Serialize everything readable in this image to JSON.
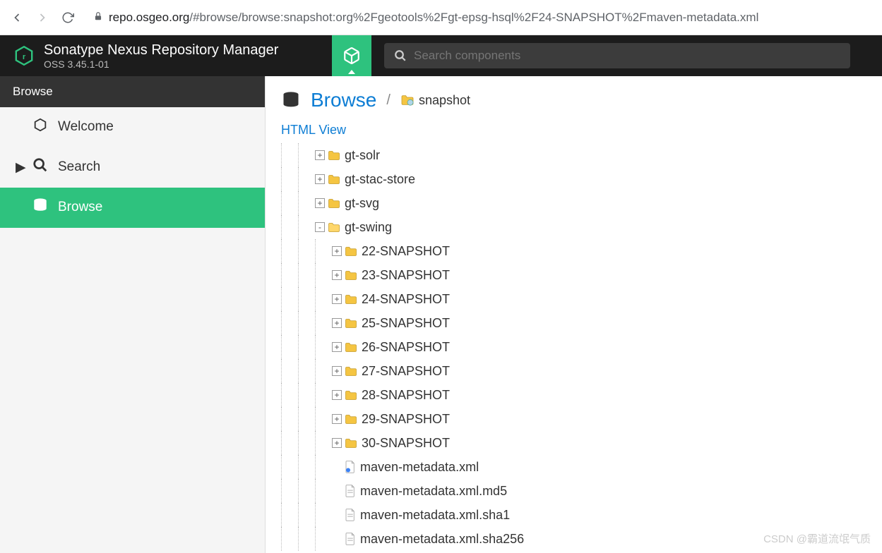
{
  "browser": {
    "url_prefix": "repo.osgeo.org",
    "url_path": "/#browse/browse:snapshot:org%2Fgeotools%2Fgt-epsg-hsql%2F24-SNAPSHOT%2Fmaven-metadata.xml"
  },
  "header": {
    "title": "Sonatype Nexus Repository Manager",
    "version": "OSS 3.45.1-01",
    "search_placeholder": "Search components"
  },
  "sidebar": {
    "header": "Browse",
    "items": [
      {
        "label": "Welcome",
        "icon": "hex",
        "active": false,
        "expandable": false
      },
      {
        "label": "Search",
        "icon": "search",
        "active": false,
        "expandable": true
      },
      {
        "label": "Browse",
        "icon": "db",
        "active": true,
        "expandable": false
      }
    ]
  },
  "breadcrumb": {
    "title": "Browse",
    "repo": "snapshot"
  },
  "links": {
    "html_view": "HTML View"
  },
  "tree": [
    {
      "depth": 2,
      "toggle": "+",
      "icon": "folder",
      "label": "gt-solr"
    },
    {
      "depth": 2,
      "toggle": "+",
      "icon": "folder",
      "label": "gt-stac-store"
    },
    {
      "depth": 2,
      "toggle": "+",
      "icon": "folder",
      "label": "gt-svg"
    },
    {
      "depth": 2,
      "toggle": "-",
      "icon": "folder-open",
      "label": "gt-swing"
    },
    {
      "depth": 3,
      "toggle": "+",
      "icon": "folder",
      "label": "22-SNAPSHOT"
    },
    {
      "depth": 3,
      "toggle": "+",
      "icon": "folder",
      "label": "23-SNAPSHOT"
    },
    {
      "depth": 3,
      "toggle": "+",
      "icon": "folder",
      "label": "24-SNAPSHOT"
    },
    {
      "depth": 3,
      "toggle": "+",
      "icon": "folder",
      "label": "25-SNAPSHOT"
    },
    {
      "depth": 3,
      "toggle": "+",
      "icon": "folder",
      "label": "26-SNAPSHOT"
    },
    {
      "depth": 3,
      "toggle": "+",
      "icon": "folder",
      "label": "27-SNAPSHOT"
    },
    {
      "depth": 3,
      "toggle": "+",
      "icon": "folder",
      "label": "28-SNAPSHOT"
    },
    {
      "depth": 3,
      "toggle": "+",
      "icon": "folder",
      "label": "29-SNAPSHOT"
    },
    {
      "depth": 3,
      "toggle": "+",
      "icon": "folder",
      "label": "30-SNAPSHOT"
    },
    {
      "depth": 3,
      "toggle": "",
      "icon": "file-xml",
      "label": "maven-metadata.xml"
    },
    {
      "depth": 3,
      "toggle": "",
      "icon": "file",
      "label": "maven-metadata.xml.md5"
    },
    {
      "depth": 3,
      "toggle": "",
      "icon": "file",
      "label": "maven-metadata.xml.sha1"
    },
    {
      "depth": 3,
      "toggle": "",
      "icon": "file",
      "label": "maven-metadata.xml.sha256"
    }
  ],
  "watermark": "CSDN @霸道流氓气质"
}
